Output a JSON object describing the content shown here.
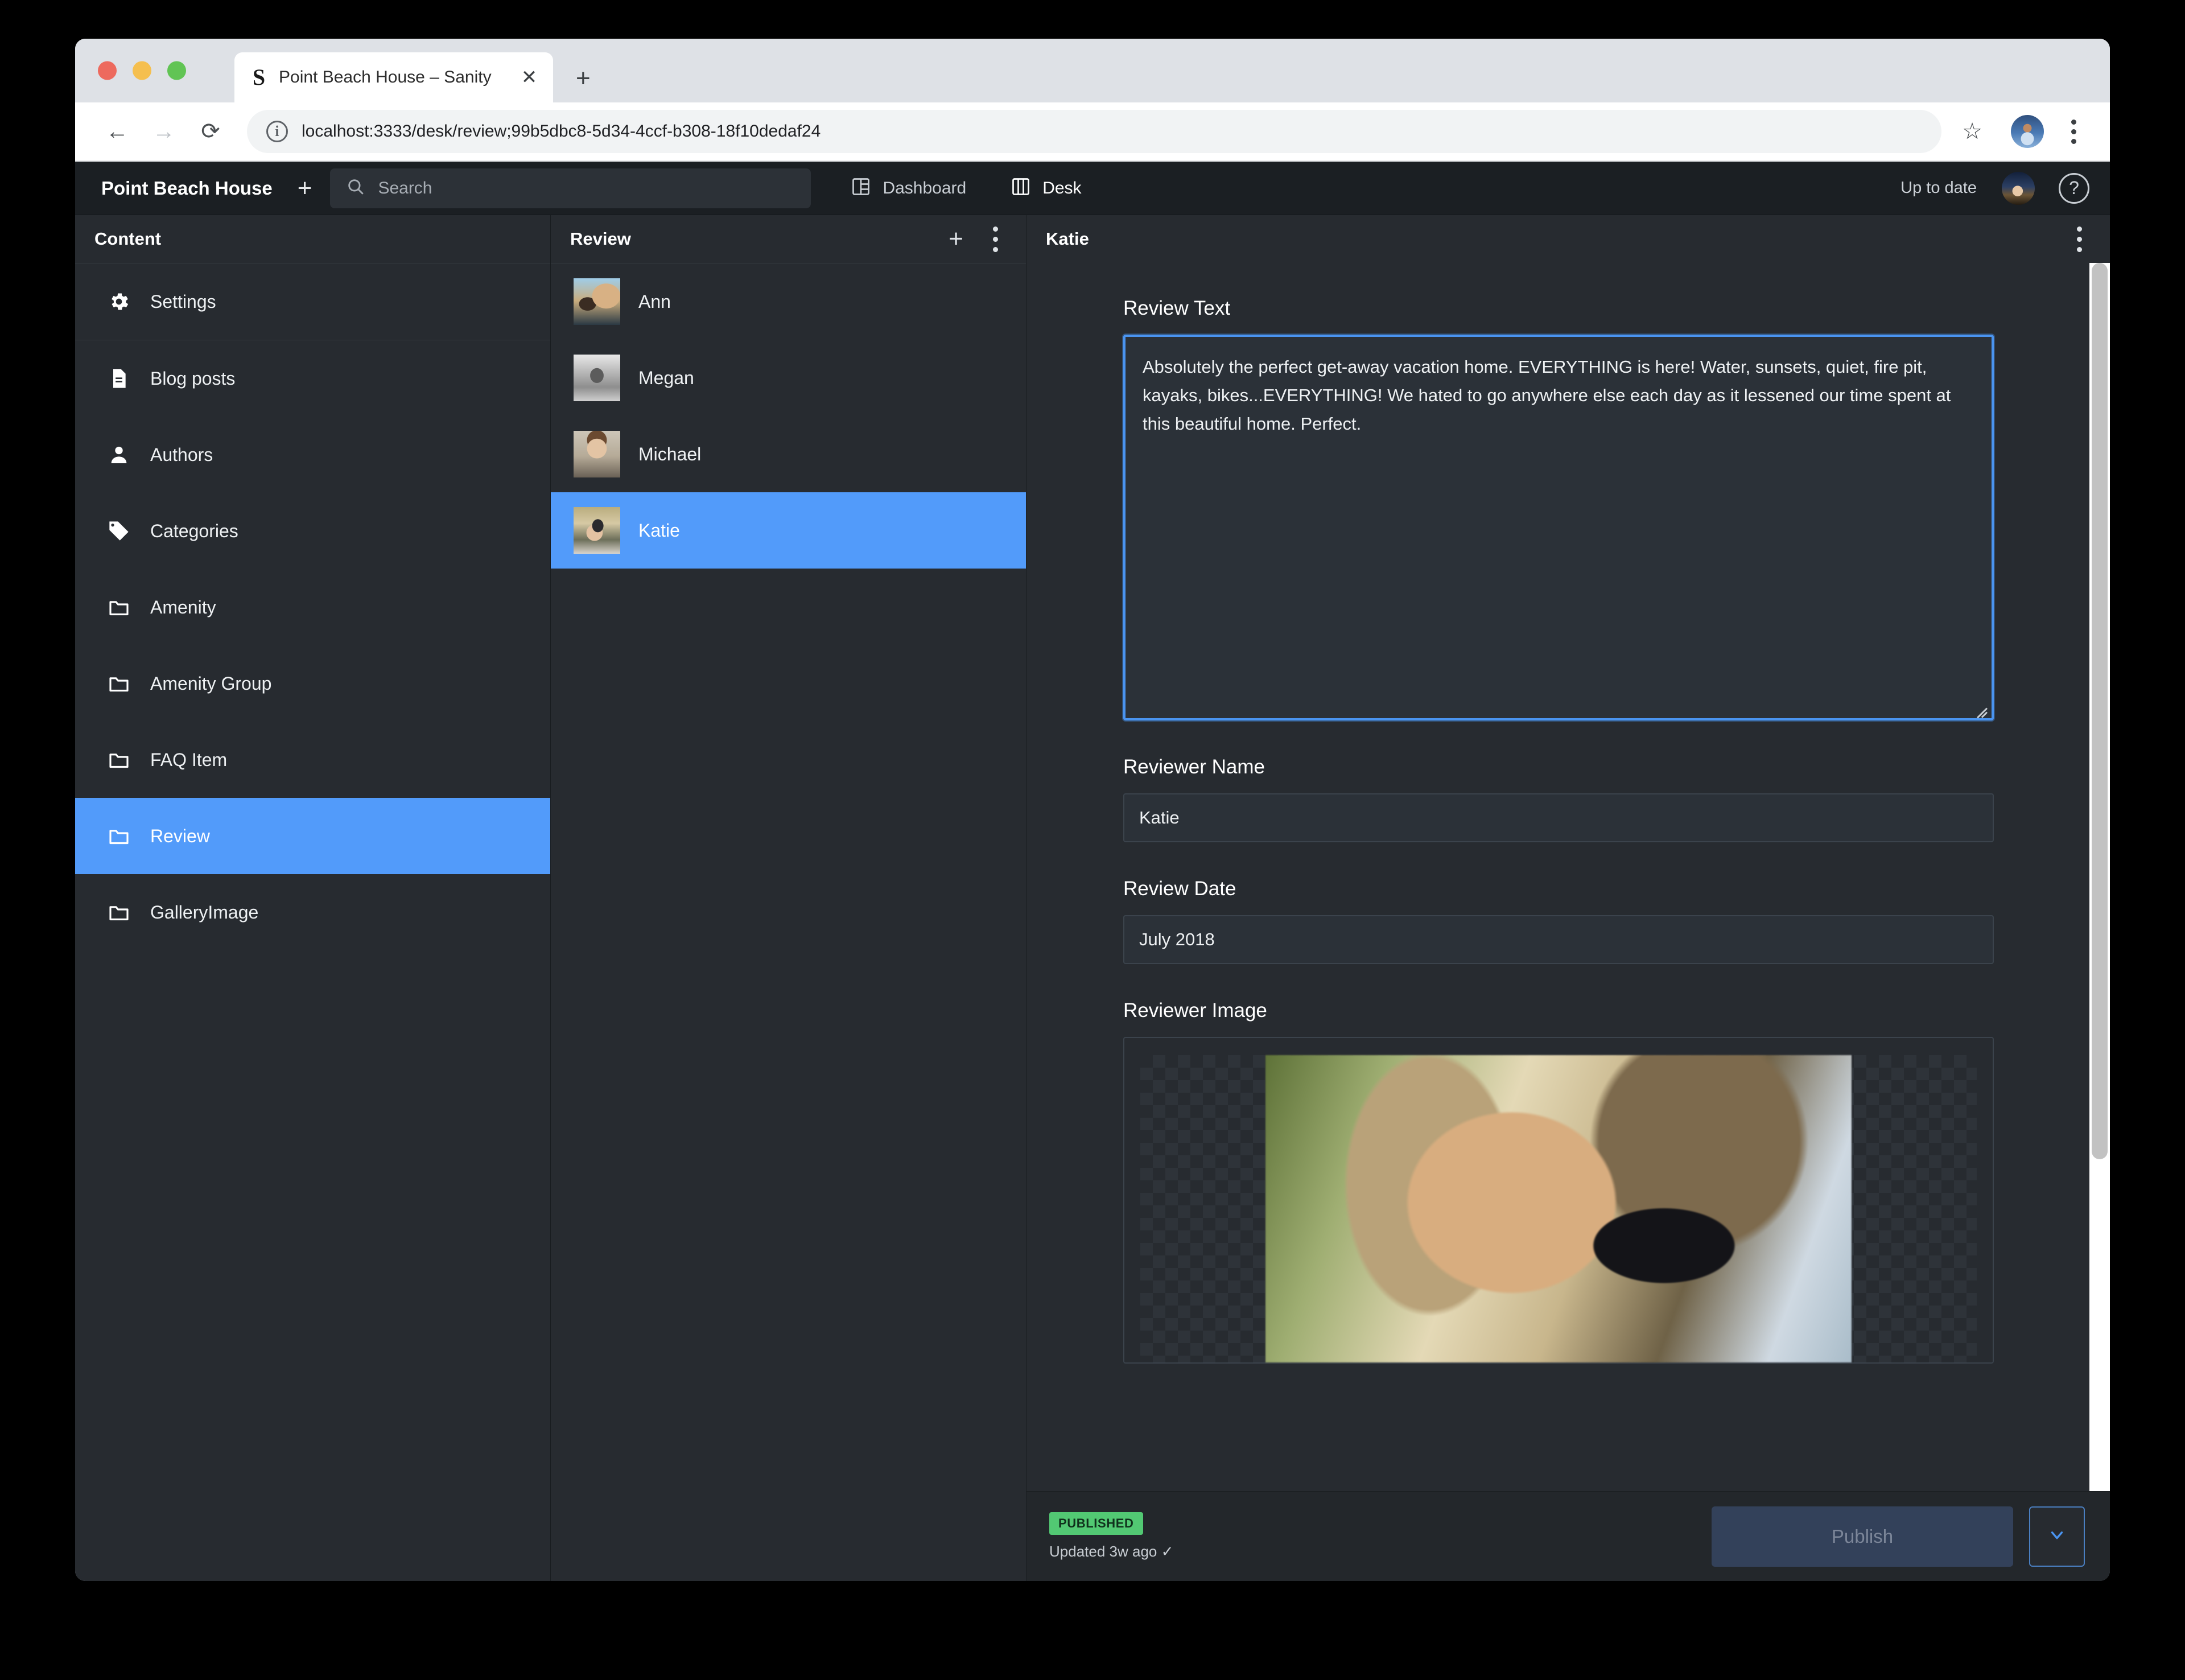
{
  "browser": {
    "tab": {
      "title": "Point Beach House – Sanity",
      "favicon_letter": "S",
      "close_icon": "close-icon"
    },
    "new_tab_label": "+",
    "back_icon": "←",
    "forward_icon": "→",
    "reload_icon": "⟳",
    "url": "localhost:3333/desk/review;99b5dbc8-5d34-4ccf-b308-18f10dedaf24",
    "site_info_icon": "i",
    "star_icon": "☆",
    "menu_icon": "kebab-menu-icon"
  },
  "app_header": {
    "brand": "Point Beach House",
    "add_icon": "+",
    "search": {
      "placeholder": "Search",
      "value": ""
    },
    "nav": [
      {
        "label": "Dashboard",
        "icon": "dashboard-grid-icon",
        "active": false
      },
      {
        "label": "Desk",
        "icon": "desk-columns-icon",
        "active": true
      }
    ],
    "status": "Up to date",
    "avatar": "user-avatar",
    "help_icon": "?"
  },
  "sidebar": {
    "title": "Content",
    "items": [
      {
        "label": "Settings",
        "icon": "gear-icon",
        "selected": false
      },
      {
        "label": "Blog posts",
        "icon": "document-icon",
        "selected": false
      },
      {
        "label": "Authors",
        "icon": "person-icon",
        "selected": false
      },
      {
        "label": "Categories",
        "icon": "tag-icon",
        "selected": false
      },
      {
        "label": "Amenity",
        "icon": "folder-icon",
        "selected": false
      },
      {
        "label": "Amenity Group",
        "icon": "folder-icon",
        "selected": false
      },
      {
        "label": "FAQ Item",
        "icon": "folder-icon",
        "selected": false
      },
      {
        "label": "Review",
        "icon": "folder-icon",
        "selected": true
      },
      {
        "label": "GalleryImage",
        "icon": "folder-icon",
        "selected": false
      }
    ]
  },
  "list_pane": {
    "title": "Review",
    "create_icon": "+",
    "menu_icon": "kebab-menu-icon",
    "documents": [
      {
        "label": "Ann",
        "thumb": "ann",
        "selected": false
      },
      {
        "label": "Megan",
        "thumb": "megan",
        "selected": false
      },
      {
        "label": "Michael",
        "thumb": "michael",
        "selected": false
      },
      {
        "label": "Katie",
        "thumb": "katie",
        "selected": true
      }
    ]
  },
  "document": {
    "title": "Katie",
    "menu_icon": "kebab-menu-icon",
    "fields": {
      "review_text": {
        "label": "Review Text",
        "value": "Absolutely the perfect get-away vacation home. EVERYTHING is here! Water, sunsets, quiet, fire pit, kayaks, bikes...EVERYTHING! We hated to go anywhere else each day as it lessened our time spent at this beautiful home. Perfect."
      },
      "reviewer_name": {
        "label": "Reviewer Name",
        "value": "Katie"
      },
      "review_date": {
        "label": "Review Date",
        "value": "July 2018"
      },
      "reviewer_image": {
        "label": "Reviewer Image"
      }
    },
    "footer": {
      "status_badge": "PUBLISHED",
      "updated": "Updated 3w ago ✓",
      "publish_label": "Publish",
      "publish_caret_icon": "chevron-down-icon"
    }
  },
  "colors": {
    "accent_blue": "#529bfa",
    "focus_blue": "#4a94f0",
    "published_green": "#52c873",
    "pane_bg": "#272b30",
    "header_bg": "#1b1f23"
  }
}
